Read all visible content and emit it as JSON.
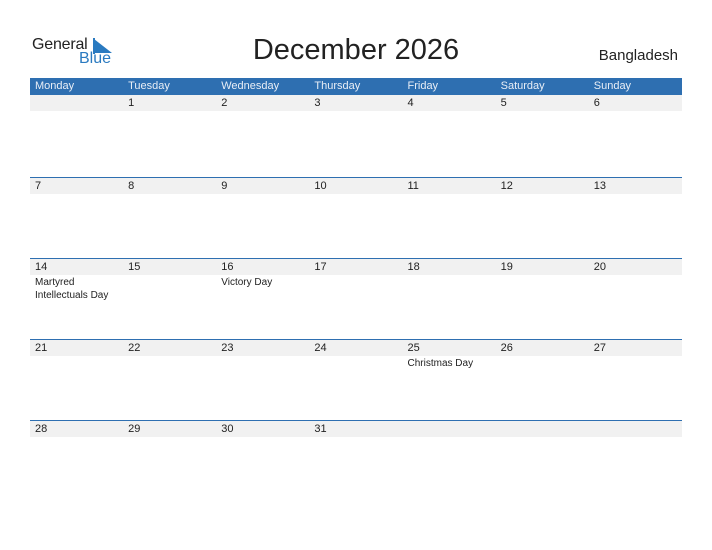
{
  "logo": {
    "general": "General",
    "blue": "Blue"
  },
  "header": {
    "title": "December 2026",
    "country": "Bangladesh"
  },
  "colors": {
    "accent": "#2e6fb1",
    "date_strip": "#f1f1f1"
  },
  "weekdays": [
    "Monday",
    "Tuesday",
    "Wednesday",
    "Thursday",
    "Friday",
    "Saturday",
    "Sunday"
  ],
  "weeks": [
    {
      "dates": [
        "",
        "1",
        "2",
        "3",
        "4",
        "5",
        "6"
      ],
      "events": [
        "",
        "",
        "",
        "",
        "",
        "",
        ""
      ]
    },
    {
      "dates": [
        "7",
        "8",
        "9",
        "10",
        "11",
        "12",
        "13"
      ],
      "events": [
        "",
        "",
        "",
        "",
        "",
        "",
        ""
      ]
    },
    {
      "dates": [
        "14",
        "15",
        "16",
        "17",
        "18",
        "19",
        "20"
      ],
      "events": [
        "Martyred Intellectuals Day",
        "",
        "Victory Day",
        "",
        "",
        "",
        ""
      ]
    },
    {
      "dates": [
        "21",
        "22",
        "23",
        "24",
        "25",
        "26",
        "27"
      ],
      "events": [
        "",
        "",
        "",
        "",
        "Christmas Day",
        "",
        ""
      ]
    },
    {
      "dates": [
        "28",
        "29",
        "30",
        "31",
        "",
        "",
        ""
      ],
      "events": [
        "",
        "",
        "",
        "",
        "",
        "",
        ""
      ]
    }
  ]
}
